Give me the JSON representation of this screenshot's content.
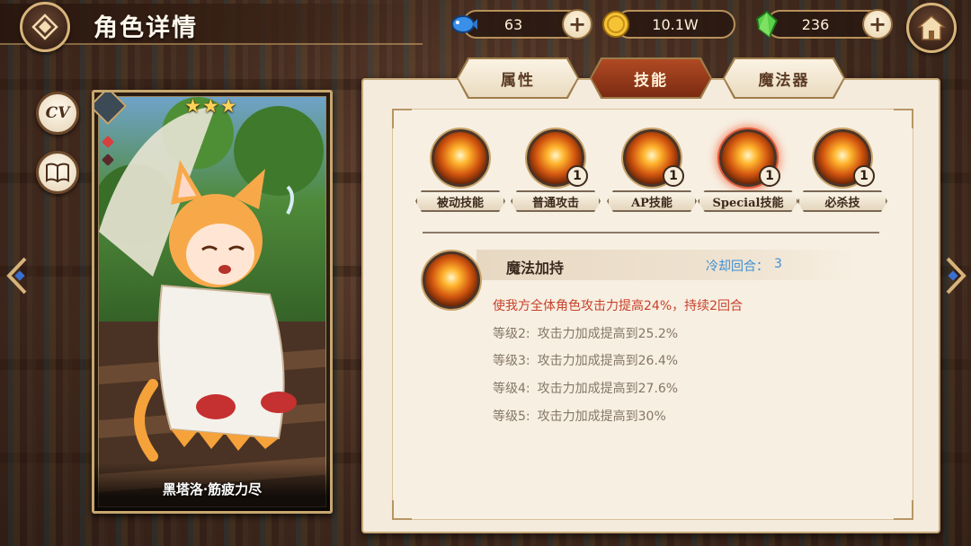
{
  "header": {
    "title": "角色详情"
  },
  "resources": [
    {
      "name": "fish-currency",
      "value": "63"
    },
    {
      "name": "gold-coin",
      "value": "10.1W"
    },
    {
      "name": "green-crystal",
      "value": "236"
    }
  ],
  "side_buttons": {
    "cv_label": "CV"
  },
  "card": {
    "character_name": "黑塔洛·筋疲力尽",
    "stars": [
      "★",
      "★",
      "★"
    ]
  },
  "tabs": [
    {
      "label": "属性",
      "active": false
    },
    {
      "label": "技能",
      "active": true
    },
    {
      "label": "魔法器",
      "active": false
    }
  ],
  "skills": [
    {
      "label": "被动技能",
      "level": ""
    },
    {
      "label": "普通攻击",
      "level": "1"
    },
    {
      "label": "AP技能",
      "level": "1"
    },
    {
      "label": "Special技能",
      "level": "1",
      "selected": true
    },
    {
      "label": "必杀技",
      "level": "1"
    }
  ],
  "detail": {
    "name": "魔法加持",
    "cooldown_label": "冷却回合：",
    "cooldown_value": "3",
    "description": "使我方全体角色攻击力提高24%，持续2回合",
    "levels": [
      {
        "level": "等级2:",
        "text": "攻击力加成提高到25.2%"
      },
      {
        "level": "等级3:",
        "text": "攻击力加成提高到26.4%"
      },
      {
        "level": "等级4:",
        "text": "攻击力加成提高到27.6%"
      },
      {
        "level": "等级5:",
        "text": "攻击力加成提高到30%"
      }
    ]
  },
  "colors": {
    "accent_red": "#c8412a",
    "cooldown_blue": "#3b8fd6",
    "active_tab": "#9b3c1a"
  }
}
